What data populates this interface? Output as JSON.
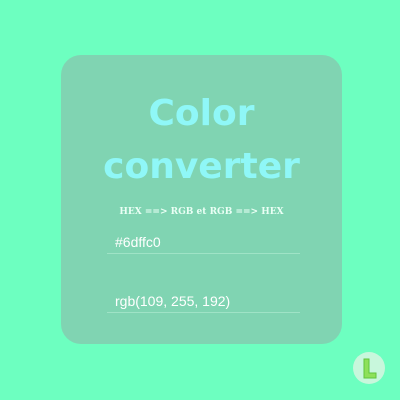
{
  "card": {
    "title": "Color converter",
    "subtitle": "HEX ==> RGB et RGB ==> HEX"
  },
  "hex_input": {
    "value": "#6dffc0"
  },
  "rgb_input": {
    "value": "rgb(109, 255, 192)"
  },
  "logo": {
    "icon": "letter-l-logo-icon"
  },
  "colors": {
    "background": "#6dffc0",
    "card": "#80d4b2",
    "title": "#8ff7f7"
  }
}
